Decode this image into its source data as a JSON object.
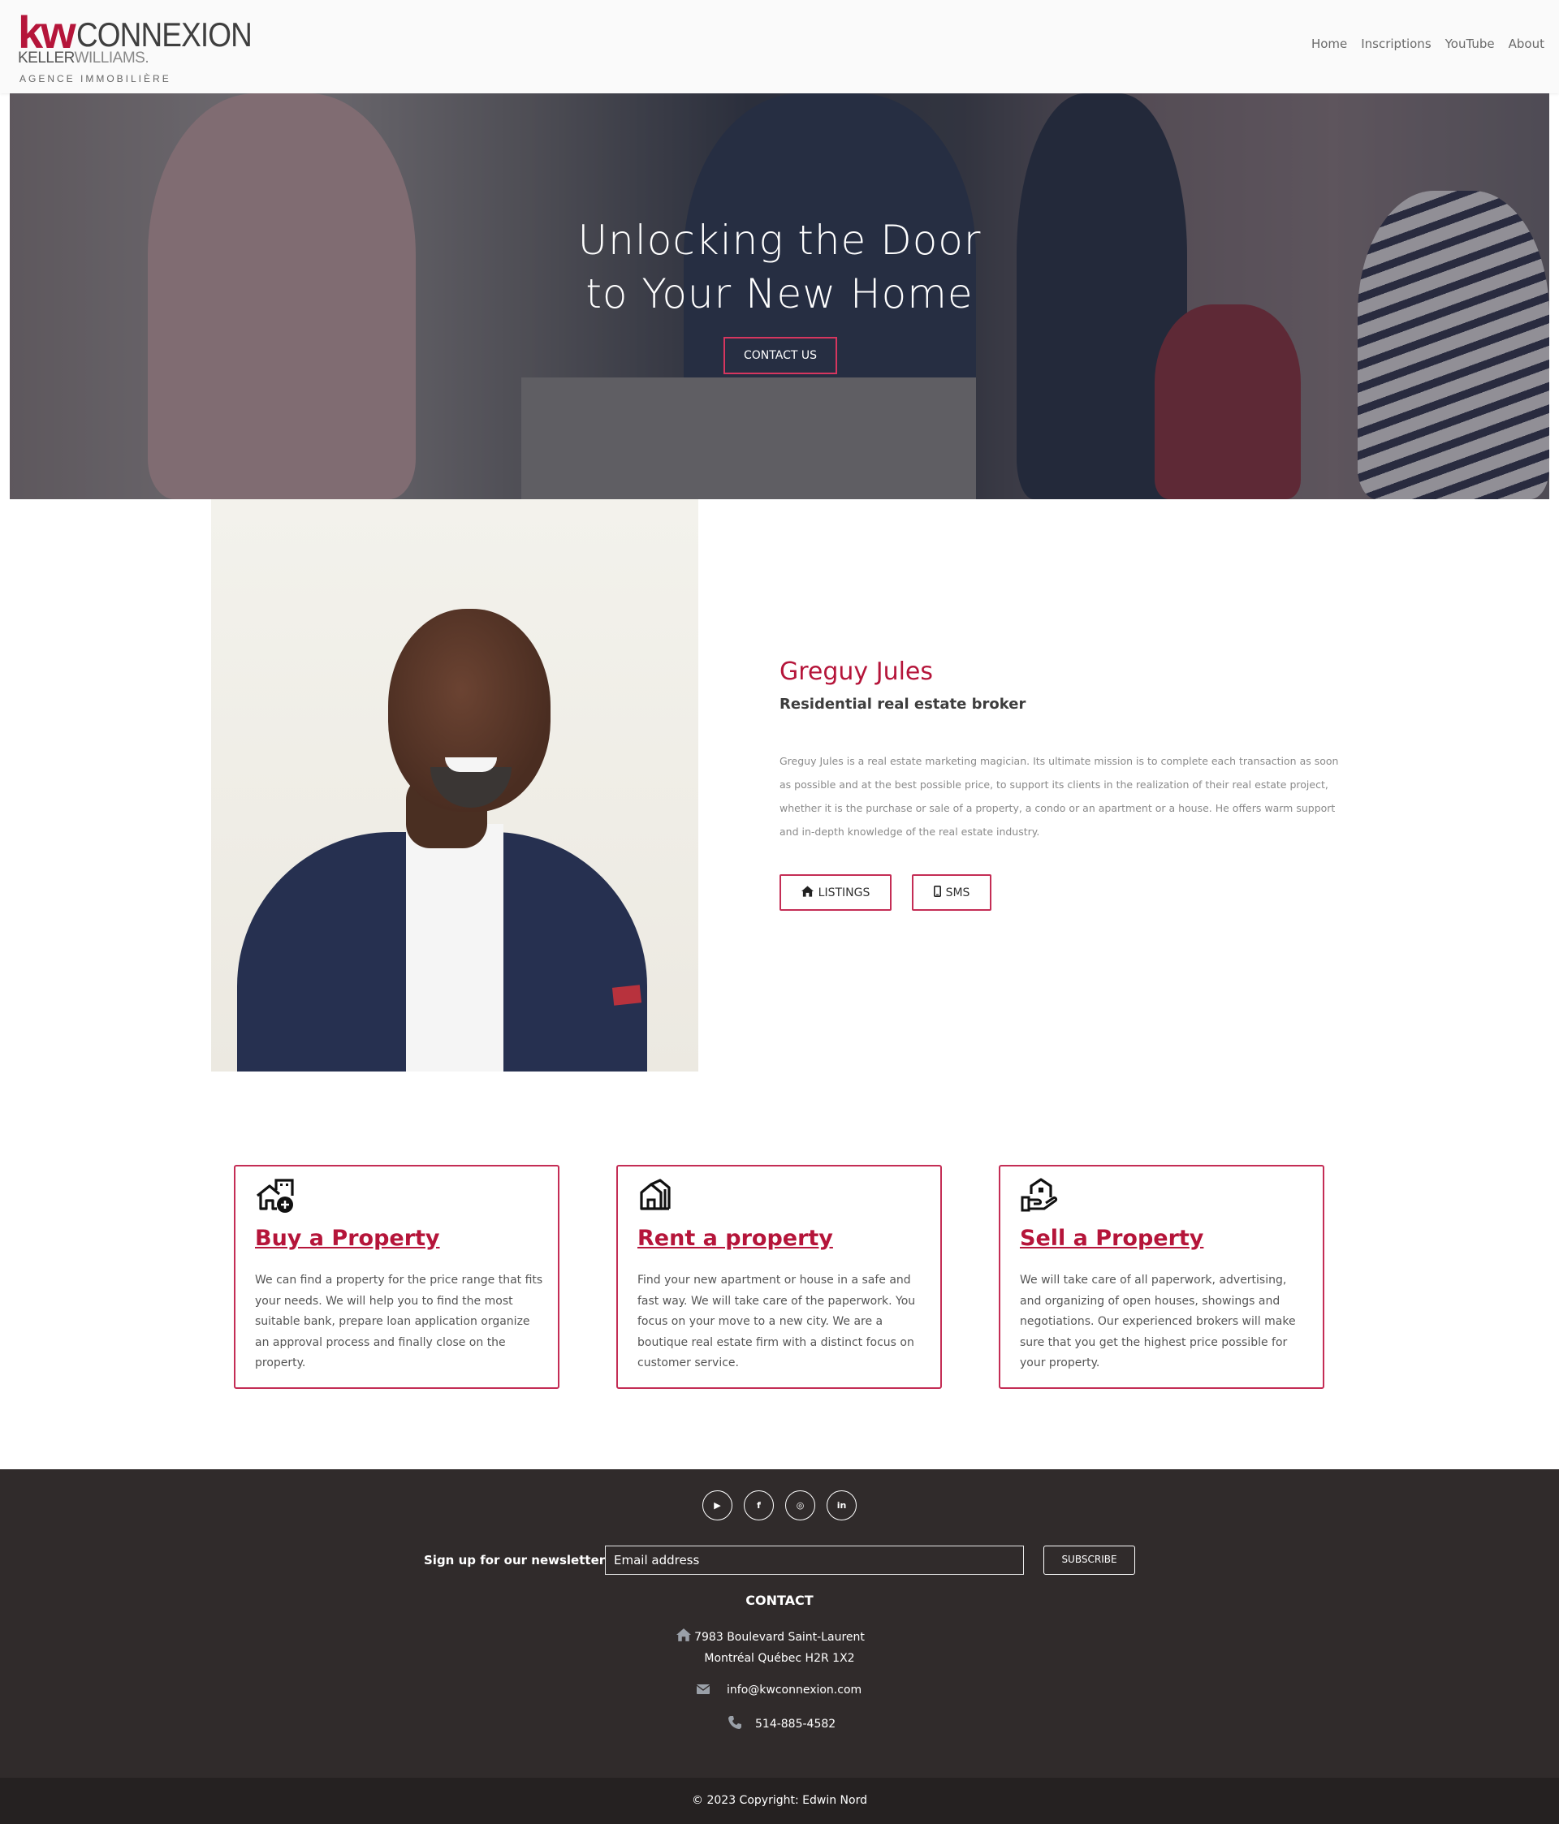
{
  "brand": {
    "logo_kw": "kw",
    "logo_connexion": "CONNEXION",
    "logo_keller": "KELLER",
    "logo_williams": "WILLIAMS.",
    "logo_agence": "AGENCE IMMOBILIÈRE",
    "accent_color": "#b5153a"
  },
  "nav": {
    "items": [
      {
        "label": "Home"
      },
      {
        "label": "Inscriptions"
      },
      {
        "label": "YouTube"
      },
      {
        "label": "About"
      }
    ]
  },
  "hero": {
    "title_line1": "Unlocking the Door",
    "title_line2": "to Your New Home",
    "cta_label": "CONTACT US"
  },
  "agent": {
    "name": "Greguy Jules",
    "role": "Residential real estate broker",
    "bio": "Greguy Jules is a real estate marketing magician. Its ultimate mission is to complete each transaction as soon as possible and at the best possible price, to support its clients in the realization of their real estate project, whether it is the purchase or sale of a property, a condo or an apartment or a house. He offers warm support and in-depth knowledge of the real estate industry.",
    "listings_label": "LISTINGS",
    "sms_label": "SMS",
    "listings_icon": "home-icon",
    "sms_icon": "mobile-phone-icon"
  },
  "services": [
    {
      "icon": "buy-house-icon",
      "title": "Buy a Property",
      "text": "We can find a property for the price range that fits your needs. We will help you to find the most suitable bank, prepare loan application organize an approval process and finally close on the property."
    },
    {
      "icon": "rent-building-icon",
      "title": "Rent a property",
      "text": "Find your new apartment or house in a safe and fast way. We will take care of the paperwork. You focus on your move to a new city. We are a boutique real estate firm with a distinct focus on customer service."
    },
    {
      "icon": "sell-house-hand-icon",
      "title": "Sell a Property",
      "text": "We will take care of all paperwork, advertising, and organizing of open houses, showings and negotiations. Our experienced brokers will make sure that you get the highest price possible for your property."
    }
  ],
  "footer": {
    "social": [
      {
        "icon": "youtube-icon",
        "glyph": "▶"
      },
      {
        "icon": "facebook-icon",
        "glyph": "f"
      },
      {
        "icon": "instagram-icon",
        "glyph": "◎"
      },
      {
        "icon": "linkedin-icon",
        "glyph": "in"
      }
    ],
    "newsletter_label": "Sign up for our newsletter",
    "newsletter_placeholder": "Email address",
    "subscribe_label": "SUBSCRIBE",
    "contact_heading": "CONTACT",
    "address_line1": "7983 Boulevard Saint-Laurent",
    "address_line2": "Montréal Québec H2R 1X2",
    "email": "info@kwconnexion.com",
    "phone": "514-885-4582",
    "copyright": "© 2023 Copyright: Edwin Nord"
  }
}
